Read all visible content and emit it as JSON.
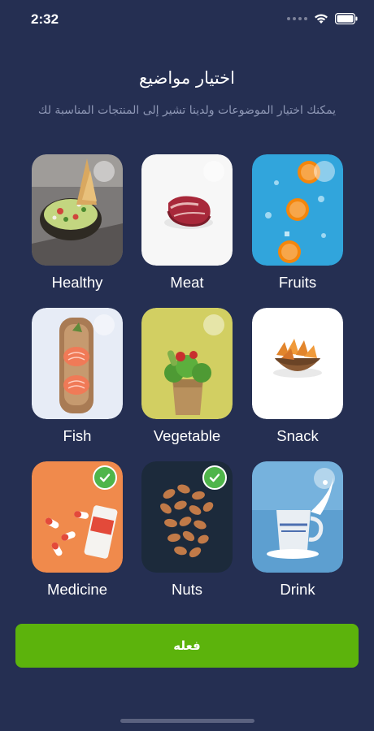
{
  "status_bar": {
    "time": "2:32"
  },
  "header": {
    "title": "اختيار مواضيع",
    "subtitle": "يمكنك اختيار الموضوعات ولدينا تشير إلى المنتجات المناسبة لك"
  },
  "categories": [
    {
      "label": "Healthy",
      "selected": false
    },
    {
      "label": "Meat",
      "selected": false
    },
    {
      "label": "Fruits",
      "selected": false
    },
    {
      "label": "Fish",
      "selected": false
    },
    {
      "label": "Vegetable",
      "selected": false
    },
    {
      "label": "Snack",
      "selected": false
    },
    {
      "label": "Medicine",
      "selected": true
    },
    {
      "label": "Nuts",
      "selected": true
    },
    {
      "label": "Drink",
      "selected": false
    }
  ],
  "action_button": {
    "label": "فعله"
  },
  "colors": {
    "background": "#252f52",
    "accent_green": "#5cb30c",
    "check_green": "#4fb54a",
    "subtitle": "#8f98b6"
  }
}
